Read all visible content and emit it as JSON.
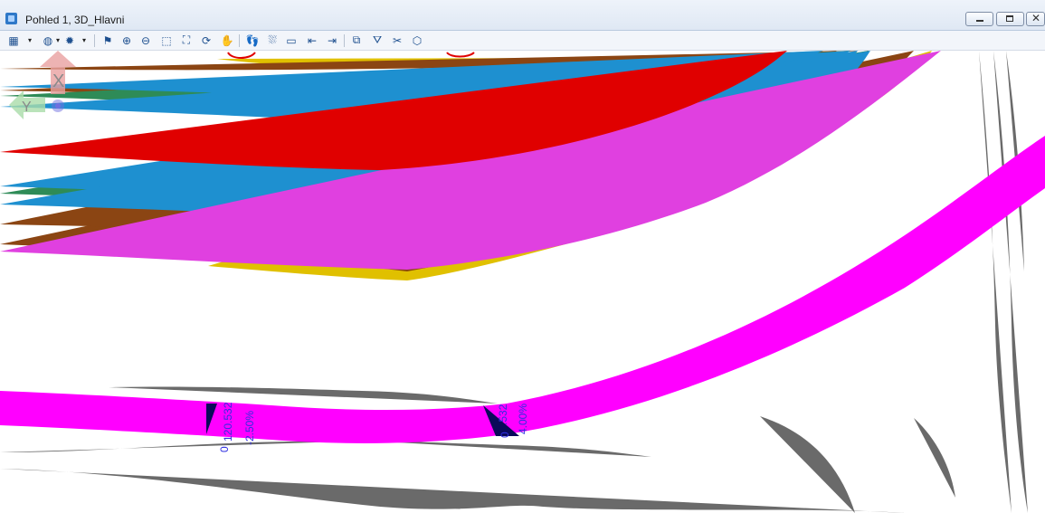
{
  "window": {
    "title": "Pohled 1, 3D_Hlavni",
    "minimize_icon": "minimize-icon",
    "maximize_icon": "restore-icon",
    "close_icon": "close-icon"
  },
  "toolbar": {
    "items": [
      {
        "icon": "view-attributes-icon",
        "glyph": "▦"
      },
      {
        "icon": "dropdown-arrow-icon",
        "glyph": "▾"
      },
      {
        "icon": "display-style-icon",
        "glyph": "◍"
      },
      {
        "icon": "dropdown-arrow-icon",
        "glyph": "▾"
      },
      {
        "icon": "lighting-icon",
        "glyph": "✹"
      },
      {
        "icon": "dropdown-arrow-icon",
        "glyph": "▾"
      },
      {
        "icon": "update-view-icon",
        "glyph": "⚑"
      },
      {
        "icon": "zoom-in-icon",
        "glyph": "⊕"
      },
      {
        "icon": "zoom-out-icon",
        "glyph": "⊖"
      },
      {
        "icon": "window-area-icon",
        "glyph": "⬚"
      },
      {
        "icon": "fit-view-icon",
        "glyph": "⛶"
      },
      {
        "icon": "rotate-view-icon",
        "glyph": "⟳"
      },
      {
        "icon": "pan-view-icon",
        "glyph": "✋"
      },
      {
        "icon": "walk-icon",
        "glyph": "👣"
      },
      {
        "icon": "fly-icon",
        "glyph": "⛆"
      },
      {
        "icon": "camera-icon",
        "glyph": "▭"
      },
      {
        "icon": "view-previous-icon",
        "glyph": "⇤"
      },
      {
        "icon": "view-next-icon",
        "glyph": "⇥"
      },
      {
        "icon": "copy-view-icon",
        "glyph": "⧉"
      },
      {
        "icon": "clip-volume-icon",
        "glyph": "⛛"
      },
      {
        "icon": "clip-mask-icon",
        "glyph": "✂"
      },
      {
        "icon": "view-display-icon",
        "glyph": "⬡"
      }
    ]
  },
  "view_rotation_widget": {
    "x_label": "X",
    "y_label": "Y",
    "x_color": "#e8a0a0",
    "y_color": "#a9dca9",
    "z_color": "#6f6fe0"
  },
  "annotations": {
    "left": {
      "line1": "0",
      "line2": "120.532",
      "line3": "-2.50%"
    },
    "right": {
      "line1": "0",
      "line2": ".532",
      "line3": "4.00%"
    }
  },
  "colors": {
    "road_magenta": "#ff00ff",
    "text_blue": "#2f2fe0",
    "marker_navy": "#0a0a5a",
    "line_brown": "#8b4513",
    "line_red": "#e00000",
    "line_blue": "#1e90d0",
    "line_yellow": "#e0c000",
    "line_green": "#2e8b57",
    "contour_grey": "#6a6a6a",
    "dashed_magenta": "#e040e0"
  }
}
